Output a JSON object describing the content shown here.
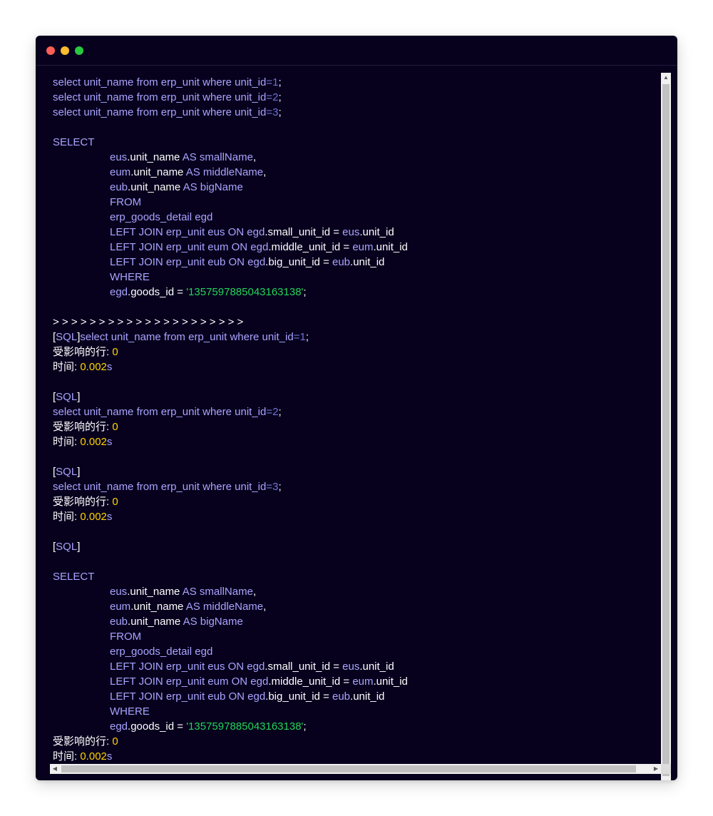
{
  "window": {
    "controls": [
      "close-dot",
      "minimize-dot",
      "maximize-dot"
    ]
  },
  "editor": {
    "lines": [
      {
        "indent": false,
        "tokens": [
          [
            "k",
            "select unit_name from erp_unit where unit_id"
          ],
          [
            "o",
            "=1"
          ],
          [
            "w",
            ";"
          ]
        ]
      },
      {
        "indent": false,
        "tokens": [
          [
            "k",
            "select unit_name from erp_unit where unit_id"
          ],
          [
            "o",
            "=2"
          ],
          [
            "w",
            ";"
          ]
        ]
      },
      {
        "indent": false,
        "tokens": [
          [
            "k",
            "select unit_name from erp_unit where unit_id"
          ],
          [
            "o",
            "=3"
          ],
          [
            "w",
            ";"
          ]
        ]
      },
      {
        "indent": false,
        "tokens": []
      },
      {
        "indent": false,
        "tokens": [
          [
            "k",
            "SELECT"
          ]
        ]
      },
      {
        "indent": true,
        "tokens": [
          [
            "k",
            "eus"
          ],
          [
            "w",
            ".unit_name "
          ],
          [
            "k",
            "AS smallName"
          ],
          [
            "w",
            ","
          ]
        ]
      },
      {
        "indent": true,
        "tokens": [
          [
            "k",
            "eum"
          ],
          [
            "w",
            ".unit_name "
          ],
          [
            "k",
            "AS middleName"
          ],
          [
            "w",
            ","
          ]
        ]
      },
      {
        "indent": true,
        "tokens": [
          [
            "k",
            "eub"
          ],
          [
            "w",
            ".unit_name "
          ],
          [
            "k",
            "AS bigName"
          ]
        ]
      },
      {
        "indent": true,
        "tokens": [
          [
            "k",
            "FROM"
          ]
        ]
      },
      {
        "indent": true,
        "tokens": [
          [
            "k",
            "erp_goods_detail egd"
          ]
        ]
      },
      {
        "indent": true,
        "tokens": [
          [
            "k",
            "LEFT JOIN erp_unit eus ON egd"
          ],
          [
            "w",
            ".small_unit_id = "
          ],
          [
            "k",
            "eus"
          ],
          [
            "w",
            ".unit_id"
          ]
        ]
      },
      {
        "indent": true,
        "tokens": [
          [
            "k",
            "LEFT JOIN erp_unit eum ON egd"
          ],
          [
            "w",
            ".middle_unit_id = "
          ],
          [
            "k",
            "eum"
          ],
          [
            "w",
            ".unit_id"
          ]
        ]
      },
      {
        "indent": true,
        "tokens": [
          [
            "k",
            "LEFT JOIN erp_unit eub ON egd"
          ],
          [
            "w",
            ".big_unit_id = "
          ],
          [
            "k",
            "eub"
          ],
          [
            "w",
            ".unit_id"
          ]
        ]
      },
      {
        "indent": true,
        "tokens": [
          [
            "k",
            "WHERE"
          ]
        ]
      },
      {
        "indent": true,
        "tokens": [
          [
            "k",
            "egd"
          ],
          [
            "w",
            ".goods_id = "
          ],
          [
            "s",
            "'1357597885043163138'"
          ],
          [
            "w",
            ";"
          ]
        ]
      },
      {
        "indent": false,
        "tokens": []
      },
      {
        "indent": false,
        "tokens": [
          [
            "w",
            "> > > > > > > > > > > > > > > > > > > > >"
          ]
        ]
      },
      {
        "indent": false,
        "tokens": [
          [
            "w",
            "["
          ],
          [
            "k",
            "SQL"
          ],
          [
            "w",
            "]"
          ],
          [
            "k",
            "select unit_name from erp_unit where unit_id"
          ],
          [
            "o",
            "=1"
          ],
          [
            "w",
            ";"
          ]
        ]
      },
      {
        "indent": false,
        "tokens": [
          [
            "w",
            "受影响的行: "
          ],
          [
            "n",
            "0"
          ]
        ]
      },
      {
        "indent": false,
        "tokens": [
          [
            "w",
            "时间: "
          ],
          [
            "n",
            "0.002"
          ],
          [
            "k",
            "s"
          ]
        ]
      },
      {
        "indent": false,
        "tokens": []
      },
      {
        "indent": false,
        "tokens": [
          [
            "w",
            "["
          ],
          [
            "k",
            "SQL"
          ],
          [
            "w",
            "]"
          ]
        ]
      },
      {
        "indent": false,
        "tokens": [
          [
            "k",
            "select unit_name from erp_unit where unit_id"
          ],
          [
            "o",
            "=2"
          ],
          [
            "w",
            ";"
          ]
        ]
      },
      {
        "indent": false,
        "tokens": [
          [
            "w",
            "受影响的行: "
          ],
          [
            "n",
            "0"
          ]
        ]
      },
      {
        "indent": false,
        "tokens": [
          [
            "w",
            "时间: "
          ],
          [
            "n",
            "0.002"
          ],
          [
            "k",
            "s"
          ]
        ]
      },
      {
        "indent": false,
        "tokens": []
      },
      {
        "indent": false,
        "tokens": [
          [
            "w",
            "["
          ],
          [
            "k",
            "SQL"
          ],
          [
            "w",
            "]"
          ]
        ]
      },
      {
        "indent": false,
        "tokens": [
          [
            "k",
            "select unit_name from erp_unit where unit_id"
          ],
          [
            "o",
            "=3"
          ],
          [
            "w",
            ";"
          ]
        ]
      },
      {
        "indent": false,
        "tokens": [
          [
            "w",
            "受影响的行: "
          ],
          [
            "n",
            "0"
          ]
        ]
      },
      {
        "indent": false,
        "tokens": [
          [
            "w",
            "时间: "
          ],
          [
            "n",
            "0.002"
          ],
          [
            "k",
            "s"
          ]
        ]
      },
      {
        "indent": false,
        "tokens": []
      },
      {
        "indent": false,
        "tokens": [
          [
            "w",
            "["
          ],
          [
            "k",
            "SQL"
          ],
          [
            "w",
            "]"
          ]
        ]
      },
      {
        "indent": false,
        "tokens": []
      },
      {
        "indent": false,
        "tokens": [
          [
            "k",
            "SELECT"
          ]
        ]
      },
      {
        "indent": true,
        "tokens": [
          [
            "k",
            "eus"
          ],
          [
            "w",
            ".unit_name "
          ],
          [
            "k",
            "AS smallName"
          ],
          [
            "w",
            ","
          ]
        ]
      },
      {
        "indent": true,
        "tokens": [
          [
            "k",
            "eum"
          ],
          [
            "w",
            ".unit_name "
          ],
          [
            "k",
            "AS middleName"
          ],
          [
            "w",
            ","
          ]
        ]
      },
      {
        "indent": true,
        "tokens": [
          [
            "k",
            "eub"
          ],
          [
            "w",
            ".unit_name "
          ],
          [
            "k",
            "AS bigName"
          ]
        ]
      },
      {
        "indent": true,
        "tokens": [
          [
            "k",
            "FROM"
          ]
        ]
      },
      {
        "indent": true,
        "tokens": [
          [
            "k",
            "erp_goods_detail egd"
          ]
        ]
      },
      {
        "indent": true,
        "tokens": [
          [
            "k",
            "LEFT JOIN erp_unit eus ON egd"
          ],
          [
            "w",
            ".small_unit_id = "
          ],
          [
            "k",
            "eus"
          ],
          [
            "w",
            ".unit_id"
          ]
        ]
      },
      {
        "indent": true,
        "tokens": [
          [
            "k",
            "LEFT JOIN erp_unit eum ON egd"
          ],
          [
            "w",
            ".middle_unit_id = "
          ],
          [
            "k",
            "eum"
          ],
          [
            "w",
            ".unit_id"
          ]
        ]
      },
      {
        "indent": true,
        "tokens": [
          [
            "k",
            "LEFT JOIN erp_unit eub ON egd"
          ],
          [
            "w",
            ".big_unit_id = "
          ],
          [
            "k",
            "eub"
          ],
          [
            "w",
            ".unit_id"
          ]
        ]
      },
      {
        "indent": true,
        "tokens": [
          [
            "k",
            "WHERE"
          ]
        ]
      },
      {
        "indent": true,
        "tokens": [
          [
            "k",
            "egd"
          ],
          [
            "w",
            ".goods_id = "
          ],
          [
            "s",
            "'1357597885043163138'"
          ],
          [
            "w",
            ";"
          ]
        ]
      },
      {
        "indent": false,
        "tokens": [
          [
            "w",
            "受影响的行: "
          ],
          [
            "n",
            "0"
          ]
        ]
      },
      {
        "indent": false,
        "tokens": [
          [
            "w",
            "时间: "
          ],
          [
            "n",
            "0.002"
          ],
          [
            "k",
            "s"
          ]
        ]
      }
    ]
  },
  "scrollbars": {
    "up_arrow": "▲",
    "down_arrow": "▼",
    "left_arrow": "◀",
    "right_arrow": "▶"
  },
  "colors": {
    "background": "#07011d",
    "keyword": "#a9a4ff",
    "plain": "#ffffff",
    "number": "#ffd400",
    "string": "#24d35a",
    "operator": "#6f74d8"
  }
}
